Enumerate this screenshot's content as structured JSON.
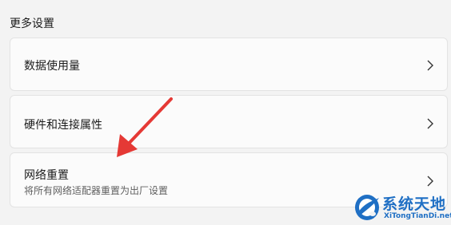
{
  "section": {
    "title": "更多设置"
  },
  "items": [
    {
      "label": "数据使用量",
      "description": ""
    },
    {
      "label": "硬件和连接属性",
      "description": ""
    },
    {
      "label": "网络重置",
      "description": "将所有网络适配器重置为出厂设置"
    }
  ],
  "watermark": {
    "name": "系统天地",
    "url": "XiTongTianDi.net"
  },
  "annotation": {
    "arrow_color": "#e53935"
  }
}
